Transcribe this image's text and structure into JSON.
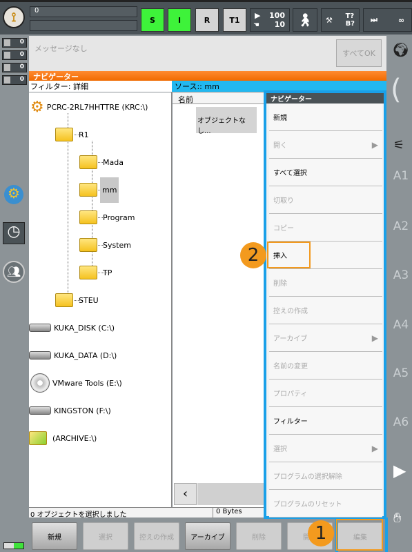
{
  "topbar": {
    "field_value": "0",
    "s": "S",
    "i": "I",
    "r": "R",
    "t1": "T1",
    "override_prog": "100",
    "override_jog": "10",
    "tool": "T?",
    "base": "B?",
    "run_mode": "∞"
  },
  "counters": [
    "0",
    "0",
    "0",
    "0"
  ],
  "message": {
    "text": "メッセージなし",
    "ok_all": "すべてOK"
  },
  "navigator": {
    "title": "ナビゲーター",
    "filter": "フィルター: 詳細",
    "source": "ソース:: mm",
    "column_name": "名前",
    "empty_item": "オブジェクトなし..."
  },
  "tree": [
    {
      "label": "PCRC-2RL7HHTTRE (KRC:\\)",
      "type": "robot"
    },
    {
      "label": "R1",
      "type": "folder"
    },
    {
      "label": "Mada",
      "type": "folder"
    },
    {
      "label": "mm",
      "type": "folder",
      "selected": true
    },
    {
      "label": "Program",
      "type": "folder"
    },
    {
      "label": "System",
      "type": "folder"
    },
    {
      "label": "TP",
      "type": "folder"
    },
    {
      "label": "STEU",
      "type": "folder"
    },
    {
      "label": "KUKA_DISK (C:\\)",
      "type": "drive"
    },
    {
      "label": "KUKA_DATA (D:\\)",
      "type": "drive"
    },
    {
      "label": "VMware Tools (E:\\)",
      "type": "cd"
    },
    {
      "label": "KINGSTON (F:\\)",
      "type": "drive"
    },
    {
      "label": "(ARCHIVE:\\)",
      "type": "archive"
    }
  ],
  "menu": {
    "title": "ナビゲーター",
    "items": [
      {
        "label": "新規",
        "enabled": true
      },
      {
        "label": "開く",
        "enabled": false,
        "submenu": true
      },
      {
        "label": "すべて選択",
        "enabled": true
      },
      {
        "label": "切取り",
        "enabled": false
      },
      {
        "label": "コピー",
        "enabled": false
      },
      {
        "label": "挿入",
        "enabled": true
      },
      {
        "label": "削除",
        "enabled": false
      },
      {
        "label": "控えの作成",
        "enabled": false
      },
      {
        "label": "アーカイブ",
        "enabled": false,
        "submenu": true
      },
      {
        "label": "名前の変更",
        "enabled": false
      },
      {
        "label": "プロパティ",
        "enabled": false
      },
      {
        "label": "フィルター",
        "enabled": true
      },
      {
        "label": "選択",
        "enabled": false,
        "submenu": true
      },
      {
        "label": "プログラムの選択解除",
        "enabled": false
      },
      {
        "label": "プログラムのリセット",
        "enabled": false
      }
    ]
  },
  "status": {
    "selected": "0 オブジェクトを選択しました",
    "size": "0 Bytes"
  },
  "buttons": [
    {
      "label": "新規",
      "enabled": true
    },
    {
      "label": "選択",
      "enabled": false
    },
    {
      "label": "控えの作成",
      "enabled": false
    },
    {
      "label": "アーカイブ",
      "enabled": true
    },
    {
      "label": "削除",
      "enabled": false
    },
    {
      "label": "開く",
      "enabled": false
    },
    {
      "label": "編集",
      "enabled": false
    }
  ],
  "axes": [
    "A1",
    "A2",
    "A3",
    "A4",
    "A5",
    "A6"
  ],
  "badges": [
    "1",
    "2"
  ],
  "colors": {
    "highlight": "#f39a1e",
    "menu_border": "#1aa0e8",
    "header": "#f06a00",
    "source": "#22b8f0"
  }
}
